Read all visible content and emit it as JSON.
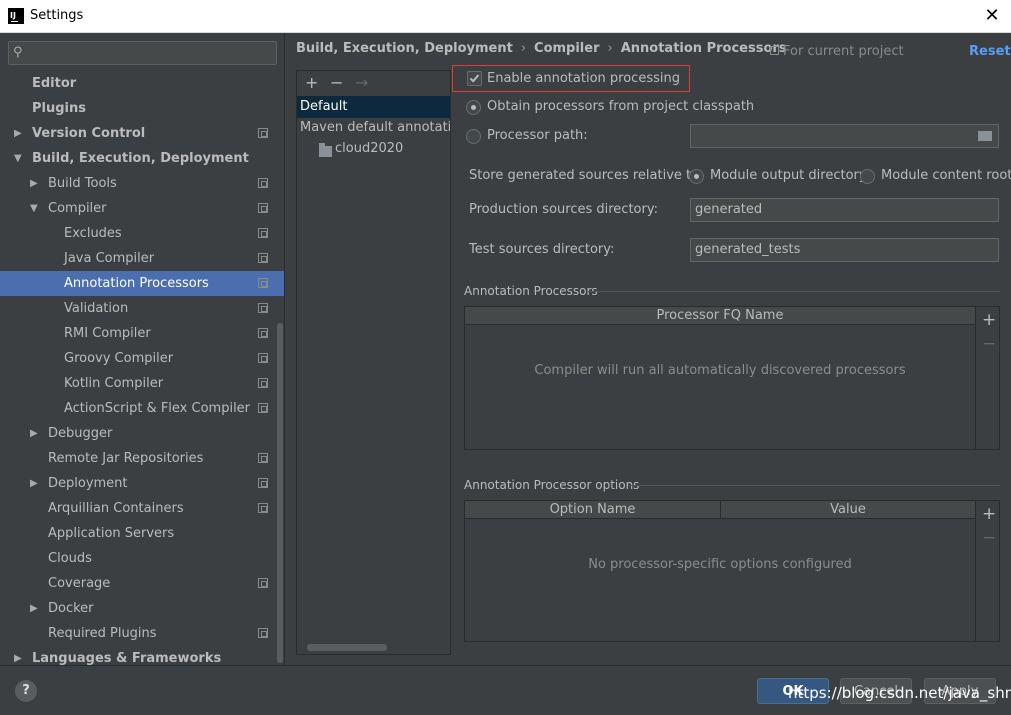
{
  "window": {
    "title": "Settings",
    "close_glyph": "✕"
  },
  "search": {
    "placeholder": "",
    "icon": "search-icon"
  },
  "tree": [
    {
      "label": "Editor",
      "bold": true,
      "indent": 0,
      "arrow": "",
      "proj": false
    },
    {
      "label": "Plugins",
      "bold": true,
      "indent": 0,
      "arrow": "",
      "proj": false
    },
    {
      "label": "Version Control",
      "bold": true,
      "indent": 0,
      "arrow": "right",
      "proj": true
    },
    {
      "label": "Build, Execution, Deployment",
      "bold": true,
      "indent": 0,
      "arrow": "down",
      "proj": false
    },
    {
      "label": "Build Tools",
      "bold": false,
      "indent": 1,
      "arrow": "right",
      "proj": true
    },
    {
      "label": "Compiler",
      "bold": false,
      "indent": 1,
      "arrow": "down",
      "proj": true
    },
    {
      "label": "Excludes",
      "bold": false,
      "indent": 2,
      "arrow": "",
      "proj": true
    },
    {
      "label": "Java Compiler",
      "bold": false,
      "indent": 2,
      "arrow": "",
      "proj": true
    },
    {
      "label": "Annotation Processors",
      "bold": false,
      "indent": 2,
      "arrow": "",
      "proj": true,
      "selected": true
    },
    {
      "label": "Validation",
      "bold": false,
      "indent": 2,
      "arrow": "",
      "proj": true
    },
    {
      "label": "RMI Compiler",
      "bold": false,
      "indent": 2,
      "arrow": "",
      "proj": true
    },
    {
      "label": "Groovy Compiler",
      "bold": false,
      "indent": 2,
      "arrow": "",
      "proj": true
    },
    {
      "label": "Kotlin Compiler",
      "bold": false,
      "indent": 2,
      "arrow": "",
      "proj": true
    },
    {
      "label": "ActionScript & Flex Compiler",
      "bold": false,
      "indent": 2,
      "arrow": "",
      "proj": true
    },
    {
      "label": "Debugger",
      "bold": false,
      "indent": 1,
      "arrow": "right",
      "proj": false
    },
    {
      "label": "Remote Jar Repositories",
      "bold": false,
      "indent": 1,
      "arrow": "",
      "proj": true
    },
    {
      "label": "Deployment",
      "bold": false,
      "indent": 1,
      "arrow": "right",
      "proj": true
    },
    {
      "label": "Arquillian Containers",
      "bold": false,
      "indent": 1,
      "arrow": "",
      "proj": true
    },
    {
      "label": "Application Servers",
      "bold": false,
      "indent": 1,
      "arrow": "",
      "proj": false
    },
    {
      "label": "Clouds",
      "bold": false,
      "indent": 1,
      "arrow": "",
      "proj": false
    },
    {
      "label": "Coverage",
      "bold": false,
      "indent": 1,
      "arrow": "",
      "proj": true
    },
    {
      "label": "Docker",
      "bold": false,
      "indent": 1,
      "arrow": "right",
      "proj": false
    },
    {
      "label": "Required Plugins",
      "bold": false,
      "indent": 1,
      "arrow": "",
      "proj": true
    },
    {
      "label": "Languages & Frameworks",
      "bold": true,
      "indent": 0,
      "arrow": "right",
      "proj": false
    }
  ],
  "breadcrumb": [
    "Build, Execution, Deployment",
    "Compiler",
    "Annotation Processors"
  ],
  "breadcrumb_sep": "›",
  "for_current_project": "For current project",
  "reset": "Reset",
  "profiles": {
    "toolbar": [
      "+",
      "−",
      "→"
    ],
    "items": [
      "Default",
      "Maven default annotation",
      "cloud2020"
    ]
  },
  "options": {
    "enable": "Enable annotation processing",
    "obtain": "Obtain processors from project classpath",
    "processor_path": "Processor path:",
    "store_relative": "Store generated sources relative to:",
    "module_output": "Module output directory",
    "module_content": "Module content root",
    "production_label": "Production sources directory:",
    "production_value": "generated",
    "test_label": "Test sources directory:",
    "test_value": "generated_tests"
  },
  "processors": {
    "title": "Annotation Processors",
    "column": "Processor FQ Name",
    "empty": "Compiler will run all automatically discovered processors"
  },
  "processor_options": {
    "title": "Annotation Processor options",
    "col_name": "Option Name",
    "col_value": "Value",
    "empty": "No processor-specific options configured"
  },
  "side_toolbar": {
    "add": "+",
    "remove": "−"
  },
  "footer": {
    "help": "?",
    "ok": "OK",
    "cancel": "Cancel",
    "apply": "Apply",
    "watermark": "https://blog.csdn.net/java_shm"
  },
  "colors": {
    "selection": "#4b6eaf",
    "accent": "#589df6",
    "highlight": "#e03a3a",
    "background": "#3c3f41"
  }
}
